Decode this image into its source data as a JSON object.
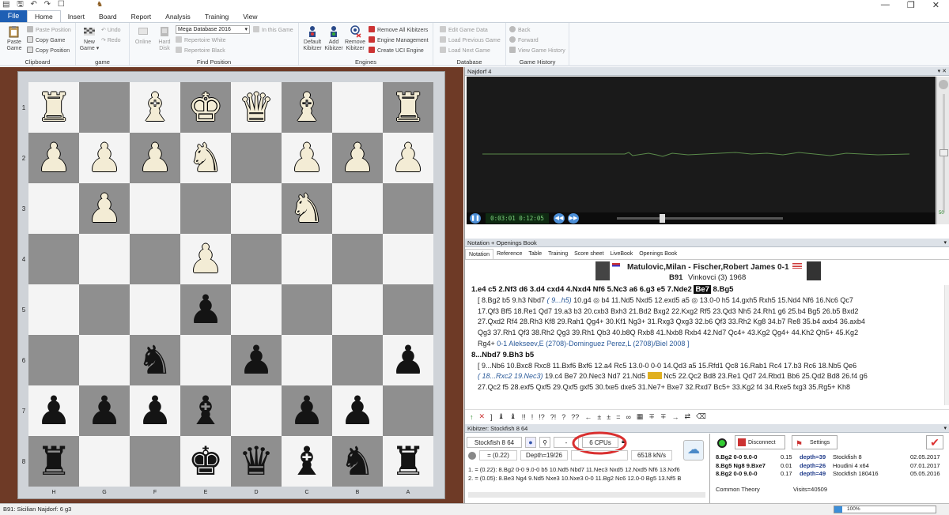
{
  "titlebar": {
    "quickaccess": "▤ 🖫 ↶ ↷ ☐",
    "app_icon": "♞"
  },
  "menu": {
    "file": "File",
    "tabs": [
      "Home",
      "Insert",
      "Board",
      "Report",
      "Analysis",
      "Training",
      "View"
    ],
    "active": "Home"
  },
  "ribbon": {
    "clipboard": {
      "label": "Clipboard",
      "paste": "Paste Game",
      "paste_position": "Paste Position",
      "copy_game": "Copy Game",
      "copy_position": "Copy Position"
    },
    "game": {
      "label": "game",
      "new_game": "New Game",
      "undo": "Undo",
      "redo": "Redo"
    },
    "find_position": {
      "label": "Find Position",
      "online": "Online",
      "hard_disk": "Hard Disk",
      "database": "Mega Database 2016",
      "in_this_game": "In this Game",
      "repertoire_white": "Repertoire White",
      "repertoire_black": "Repertoire Black"
    },
    "engines": {
      "label": "Engines",
      "default_kibitzer": "Default Kibitzer",
      "add_kibitzer": "Add Kibitzer",
      "remove_kibitzer": "Remove Kibitzer",
      "remove_all": "Remove All Kibitzers",
      "engine_mgmt": "Engine Management",
      "create_uci": "Create UCI Engine"
    },
    "database": {
      "label": "Database",
      "edit_game_data": "Edit Game Data",
      "load_previous": "Load Previous Game",
      "load_next": "Load Next Game"
    },
    "history": {
      "label": "Game History",
      "back": "Back",
      "forward": "Forward",
      "view_history": "View Game History"
    }
  },
  "board": {
    "ranks": [
      "1",
      "2",
      "3",
      "4",
      "5",
      "6",
      "7",
      "8"
    ],
    "files": [
      "H",
      "G",
      "F",
      "E",
      "D",
      "C",
      "B",
      "A"
    ],
    "pieces": [
      [
        "wR",
        "",
        "wB",
        "wK",
        "wQ",
        "wB",
        "",
        "wR"
      ],
      [
        "wP",
        "wP",
        "wP",
        "wN",
        "",
        "wP",
        "wP",
        "wP"
      ],
      [
        "",
        "wP",
        "",
        "",
        "",
        "wN",
        "",
        ""
      ],
      [
        "",
        "",
        "",
        "wP",
        "",
        "",
        "",
        ""
      ],
      [
        "",
        "",
        "",
        "bP",
        "",
        "",
        "",
        ""
      ],
      [
        "",
        "",
        "bN",
        "",
        "bP",
        "",
        "",
        "bP"
      ],
      [
        "bP",
        "bP",
        "bP",
        "bB",
        "",
        "bP",
        "bP",
        ""
      ],
      [
        "bR",
        "",
        "",
        "bK",
        "bQ",
        "bB",
        "bN",
        "bR"
      ]
    ]
  },
  "video": {
    "title": "Najdorf 4",
    "time": "0:03:01  0:12:05",
    "volume": "50"
  },
  "notation": {
    "title": "Notation + Openings Book",
    "tabs": [
      "Notation",
      "Reference",
      "Table",
      "Training",
      "Score sheet",
      "LiveBook",
      "Openings Book"
    ],
    "players": "Matulovic,Milan - Fischer,Robert James 0-1",
    "event_eco": "B91",
    "event": "Vinkovci (3) 1968",
    "main1_a": "1.e4  c5  2.Nf3  d6  3.d4  cxd4  4.Nxd4  Nf6  5.Nc3  a6  6.g3  e5  7.Nde2",
    "main1_cur": "Be7",
    "main1_b": "8.Bg5",
    "var1_a": "[ 8.Bg2  b5  9.h3  Nbd7 ",
    "var1_c": "( 9...h5)",
    "var1_b": " 10.g4  ◎  b4  11.Nd5  Nxd5  12.exd5  a5  ◎  13.0-0  h5  14.gxh5  Rxh5  15.Nd4  Nf6  16.Nc6  Qc7",
    "var1_l2": "17.Qf3  Bf5  18.Re1  Qd7  19.a3  b3  20.cxb3  Bxh3  21.Bd2  Bxg2  22.Kxg2  Rf5  23.Qd3  Nh5  24.Rh1  g6  25.b4  Bg5  26.b5  Bxd2",
    "var1_l3": "27.Qxd2  Rf4  28.Rh3  Kf8  29.Rah1  Qg4+  30.Kf1  Ng3+  31.Rxg3  Qxg3  32.b6  Qf3  33.Rh2  Kg8  34.b7  Re8  35.b4  axb4  36.axb4",
    "var1_l4": "Qg3  37.Rh1  Qf3  38.Rh2  Qg3  39.Rh1  Qb3  40.b8Q  Rxb8  41.Nxb8  Rxb4  42.Nd7  Qc4+  43.Kg2  Qg4+  44.Kh2  Qh5+  45.Kg2",
    "var1_l5a": "Rg4+ ",
    "var1_l5b": "0-1 Alekseev,E (2708)-Dominguez Perez,L (2708)/Biel 2008 ]",
    "main2": "8...Nbd7  9.Bh3  b5",
    "var2_l1": "[ 9...Nb6  10.Bxc8  Rxc8  11.Bxf6  Bxf6  12.a4  Rc5  13.0-0  0-0  14.Qd3  a5  15.Rfd1  Qc8  16.Rab1  Rc4  17.b3  Rc6  18.Nb5  Qe6",
    "var2_l2c": "( 18...Rxc2  19.Nec3)",
    "var2_l2a": " 19.c4  Be7  20.Nec3  Nd7  21.Nd5 ",
    "var2_l2b": " Nc5  22.Qc2  Bd8  23.Re1  Qd7  24.Rbd1  Bb6  25.Qd2  Bd8  26.f4  g6",
    "var2_l3": "27.Qc2  f5  28.exf5  Qxf5  29.Qxf5  gxf5  30.fxe5  dxe5  31.Ne7+  Bxe7  32.Rxd7  Bc5+  33.Kg2  f4  34.Rxe5  fxg3  35.Rg5+  Kh8"
  },
  "symbols": [
    "↑",
    "✕",
    "]",
    "♝",
    "♝",
    "!!",
    "!",
    "!?",
    "?!",
    "?",
    "??",
    "←",
    "±",
    "±",
    "=",
    "∞",
    "▦",
    "∓",
    "∓",
    "→",
    "⇄",
    "⌫"
  ],
  "kibitzer": {
    "title": "Kibitzer: Stockfish 8 64",
    "engine": "Stockfish 8 64",
    "cpus": "6 CPUs",
    "eval": "= (0.22)",
    "depth": "Depth=19/26",
    "speed": "6518 kN/s",
    "line1": "1. = (0.22): 8.Bg2 0-0 9.0-0 b5 10.Nd5 Nbd7 11.Nec3 Nxd5 12.Nxd5 Nf6 13.Nxf6",
    "line2": "2. = (0.05): 8.Be3 Ng4 9.Nd5 Nxe3 10.Nxe3 0-0 11.Bg2 Nc6 12.0-0 Bg5 13.Nf5 B"
  },
  "livebook": {
    "disconnect": "Disconnect",
    "settings": "Settings",
    "rows": [
      {
        "moves": "8.Bg2 0-0 9.0-0",
        "score": "0.15",
        "depth": "depth=39",
        "engine": "Stockfish 8",
        "date": "02.05.2017"
      },
      {
        "moves": "8.Bg5 Ng8 9.Bxe7",
        "score": "0.01",
        "depth": "depth=26",
        "engine": "Houdini 4 x64",
        "date": "07.01.2017"
      },
      {
        "moves": "8.Bg2 0-0 9.0-0",
        "score": "0.17",
        "depth": "depth=49",
        "engine": "Stockfish 180416",
        "date": "05.05.2016"
      }
    ],
    "common": "Common Theory",
    "visits": "Visits=40509"
  },
  "status": {
    "text": "B91: Sicilian Najdorf: 6 g3",
    "zoom": "100%"
  },
  "colors": {
    "accent": "#1e5fb4",
    "board_frame": "#6e3a26",
    "highlight": "#d93030"
  }
}
